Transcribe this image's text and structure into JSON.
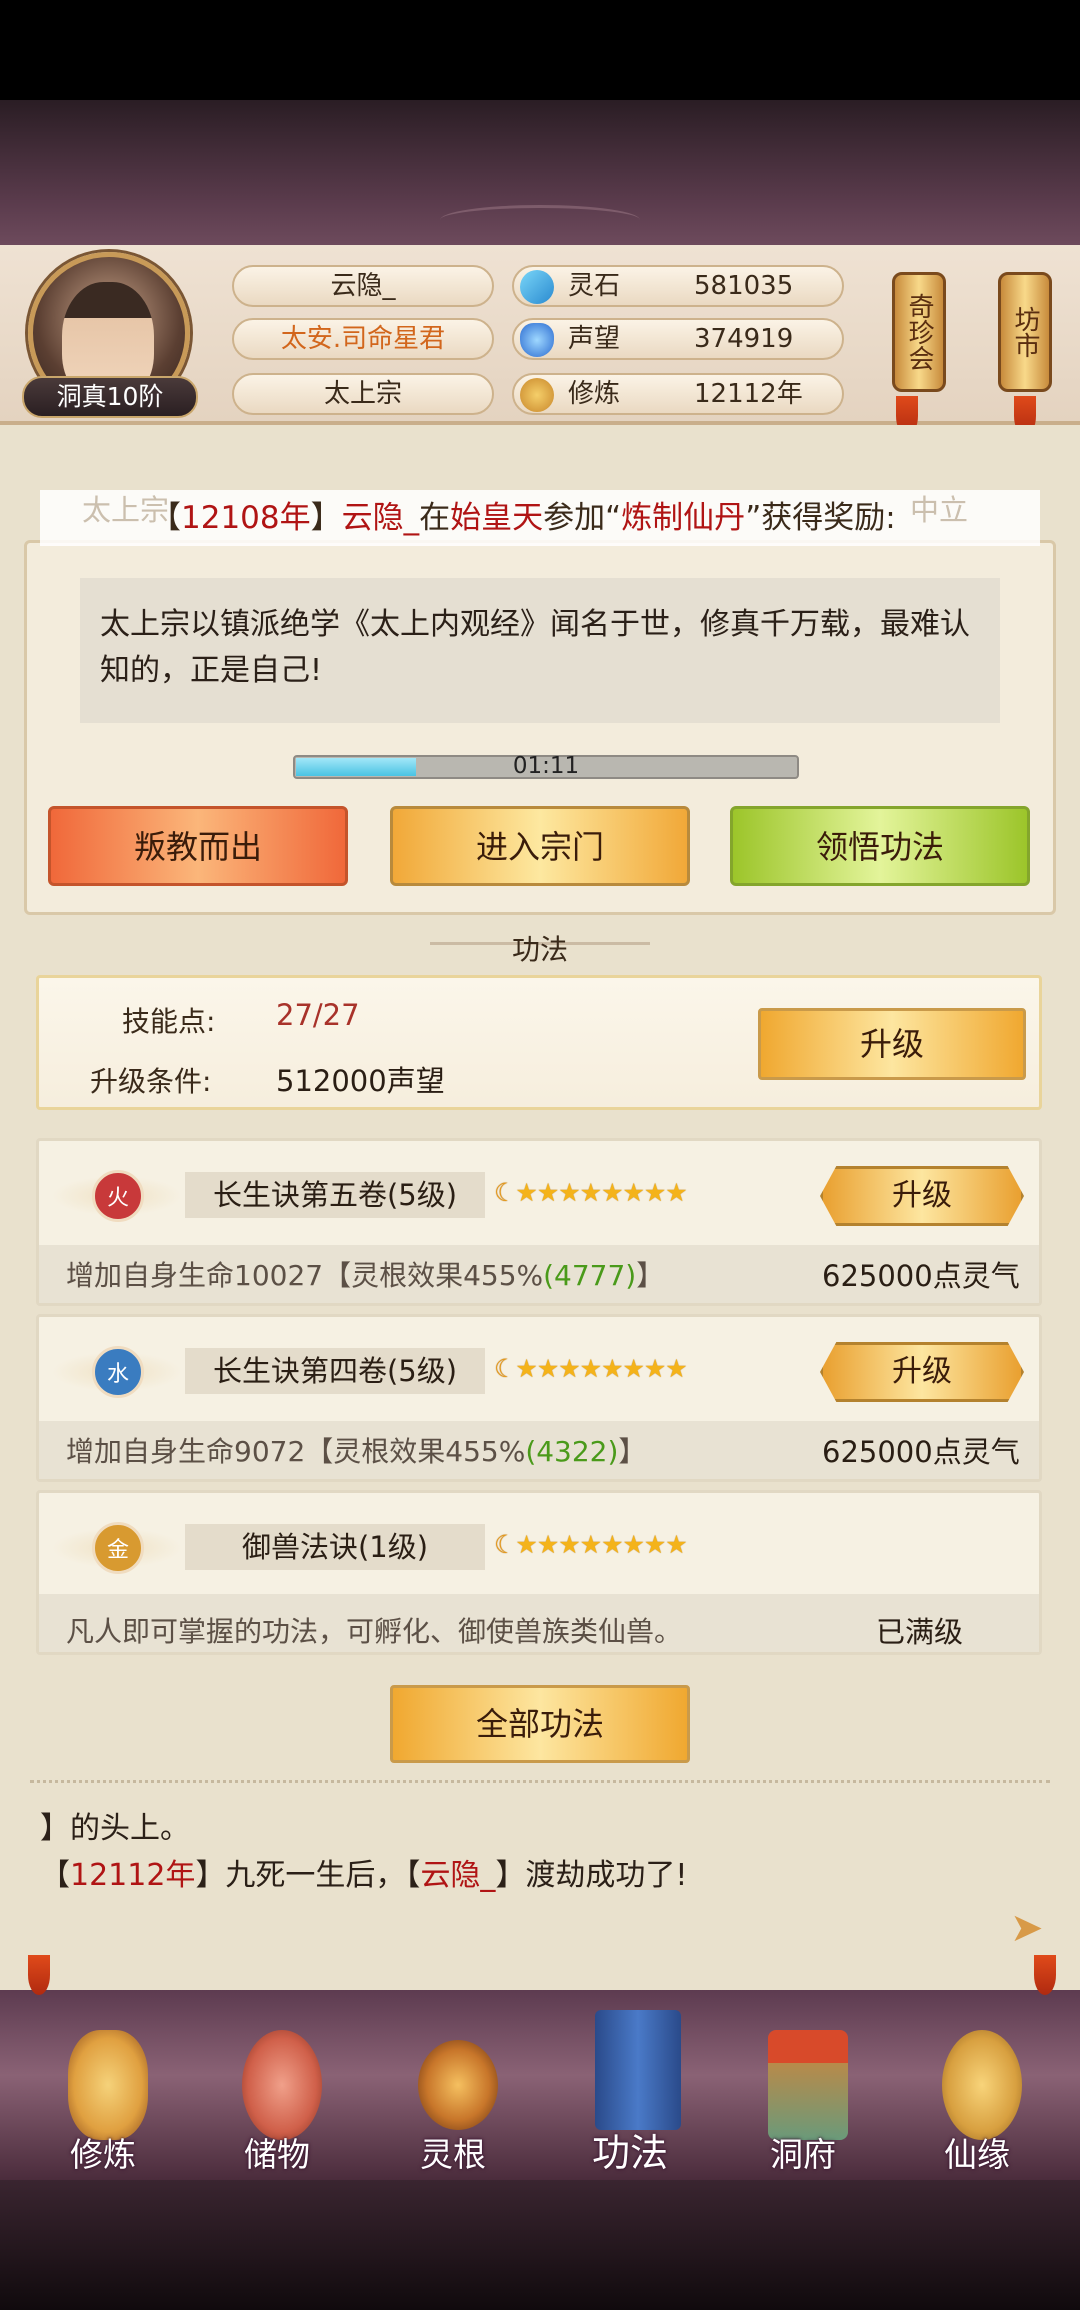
{
  "header": {
    "player_name": "云隐_",
    "title": "太安.司命星君",
    "sect": "太上宗",
    "rank": "洞真10阶",
    "resources": [
      {
        "label": "灵石",
        "value": "581035",
        "icon": "spirit-stone-icon"
      },
      {
        "label": "声望",
        "value": "374919",
        "icon": "prestige-icon"
      },
      {
        "label": "修炼",
        "value": "12112年",
        "icon": "meditation-icon"
      }
    ],
    "side_buttons": [
      "奇珍会",
      "坊市"
    ]
  },
  "marquee": {
    "ghost_left": "太上宗",
    "ghost_right": "中立",
    "p1": "【",
    "year": "12108年",
    "p2": "】",
    "name": "云隐_",
    "p3": "在",
    "place": "始皇天",
    "p4": "参加“",
    "event": "炼制仙丹",
    "p5": "”获得奖励:"
  },
  "sect_panel": {
    "motto": "太上宗以镇派绝学《太上内观经》闻名于世，修真千万载，最难认知的，正是自己!",
    "timer": "01:11",
    "timer_progress": 0.24,
    "buttons": [
      "叛教而出",
      "进入宗门",
      "领悟功法"
    ]
  },
  "section_title": "功法",
  "skill_points": {
    "label": "技能点:",
    "value": "27/27",
    "cond_label": "升级条件:",
    "cond_value": "512000声望",
    "upgrade": "升级"
  },
  "skills": [
    {
      "element": "火",
      "element_color": "#c8393a",
      "name": "长生诀第五卷(5级)",
      "stars": "★★★★★★★★",
      "upgrade": "升级",
      "desc_a": "增加自身生命10027【灵根效果455%",
      "desc_b": "(4777)",
      "desc_c": "】",
      "cost": "625000点灵气"
    },
    {
      "element": "水",
      "element_color": "#3a7cc0",
      "name": "长生诀第四卷(5级)",
      "stars": "★★★★★★★★",
      "upgrade": "升级",
      "desc_a": "增加自身生命9072【灵根效果455%",
      "desc_b": "(4322)",
      "desc_c": "】",
      "cost": "625000点灵气"
    },
    {
      "element": "金",
      "element_color": "#d89a30",
      "name": "御兽法诀(1级)",
      "stars": "★★★★★★★★",
      "desc_a": "凡人即可掌握的功法，可孵化、御使兽族类仙兽。",
      "cost": "已满级"
    }
  ],
  "all_skills_button": "全部功法",
  "chat": {
    "line1": "】的头上。",
    "l2_a": "【",
    "l2_year": "12112年",
    "l2_b": "】九死一生后，【",
    "l2_name": "云隐_",
    "l2_c": "】渡劫成功了!"
  },
  "nav": [
    {
      "label": "修炼",
      "icon": "meditation-icon",
      "color": "#e0a040"
    },
    {
      "label": "储物",
      "icon": "pouch-icon",
      "color": "#d0604a"
    },
    {
      "label": "灵根",
      "icon": "spirit-root-icon",
      "color": "#c8762a"
    },
    {
      "label": "功法",
      "icon": "scripture-book-icon",
      "color": "#3a6ab0"
    },
    {
      "label": "洞府",
      "icon": "cave-mansion-icon",
      "color": "#b88a4a"
    },
    {
      "label": "仙缘",
      "icon": "gourd-icon",
      "color": "#d8a040"
    }
  ]
}
